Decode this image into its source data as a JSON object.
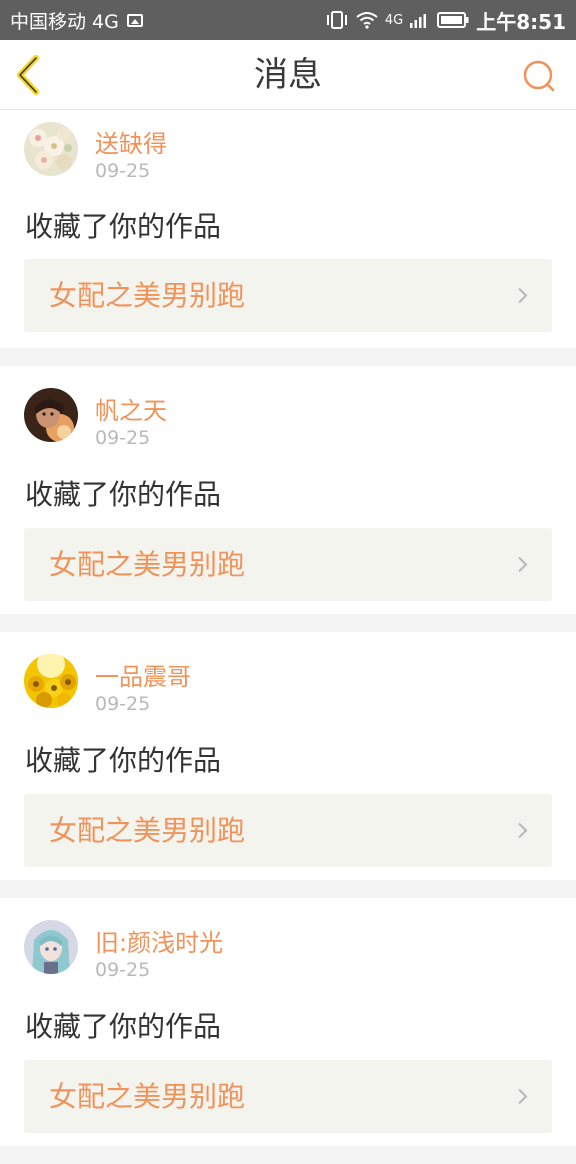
{
  "status_bar": {
    "carrier": "中国移动 4G",
    "network_small": "4G",
    "time": "上午8:51"
  },
  "header": {
    "title": "消息"
  },
  "icons": {
    "back": "chevron-left-icon",
    "search": "search-icon",
    "row_arrow": "chevron-right-icon"
  },
  "colors": {
    "accent": "#f0935a",
    "back_icon": "#f5d21e",
    "status_bar": "#5f5f5f"
  },
  "messages": [
    {
      "username": "送缺得",
      "date": "09-25",
      "action": "收藏了你的作品",
      "work_title": "女配之美男别跑"
    },
    {
      "username": "帆之天",
      "date": "09-25",
      "action": "收藏了你的作品",
      "work_title": "女配之美男别跑"
    },
    {
      "username": "一品震哥",
      "date": "09-25",
      "action": "收藏了你的作品",
      "work_title": "女配之美男别跑"
    },
    {
      "username": "旧:颜浅时光",
      "date": "09-25",
      "action": "收藏了你的作品",
      "work_title": "女配之美男别跑"
    }
  ]
}
